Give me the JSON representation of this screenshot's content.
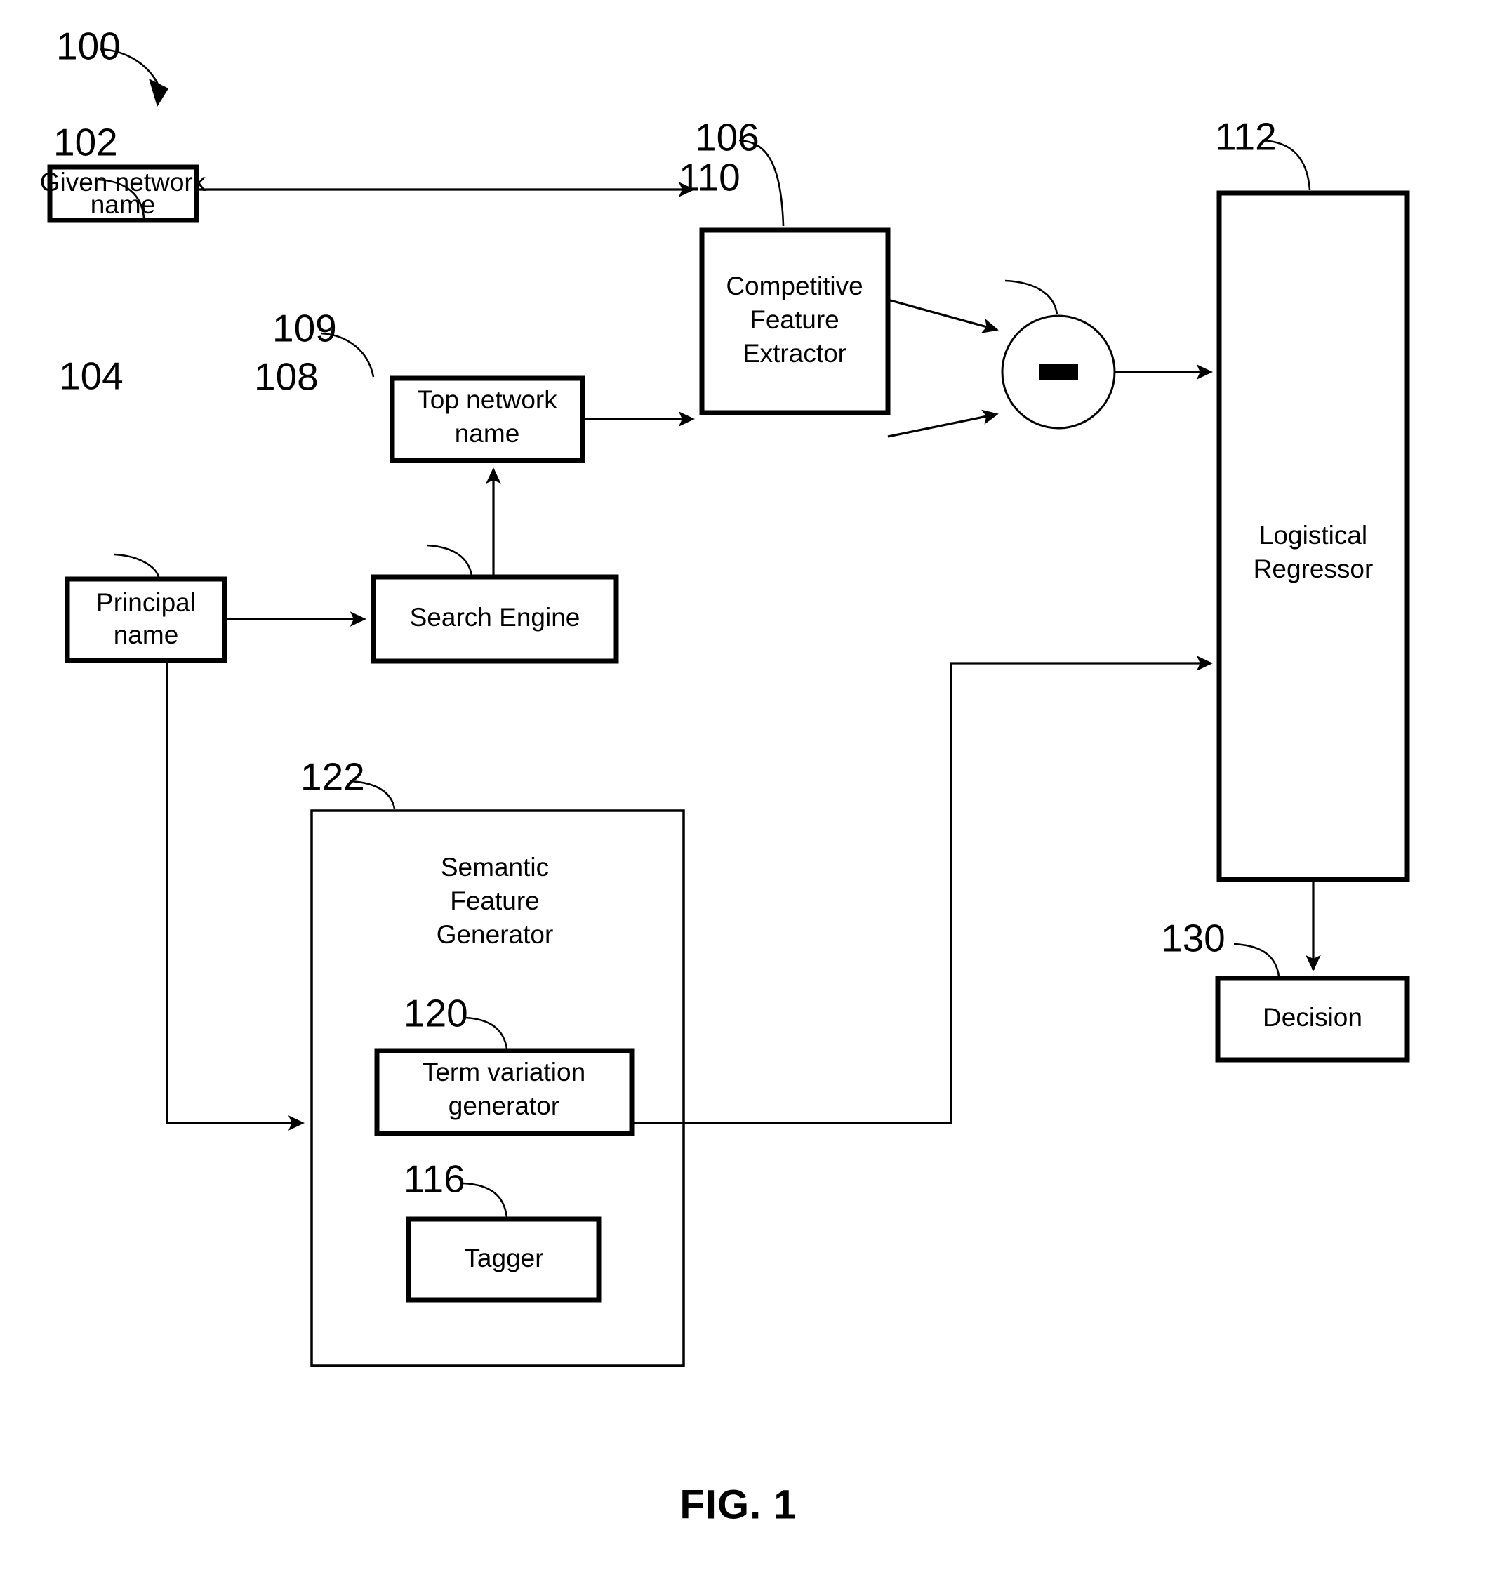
{
  "figure": {
    "caption": "FIG. 1",
    "system_ref": "100"
  },
  "nodes": [
    {
      "id": "given_network_name",
      "ref": "102",
      "label_lines": [
        "Given network",
        "name"
      ],
      "shape": "rect"
    },
    {
      "id": "principal_name",
      "ref": "104",
      "label_lines": [
        "Principal",
        "name"
      ],
      "shape": "rect"
    },
    {
      "id": "competitive_feature_extractor",
      "ref": "106",
      "label_lines": [
        "Competitive",
        "Feature",
        "Extractor"
      ],
      "shape": "rect"
    },
    {
      "id": "search_engine",
      "ref": "108",
      "label_lines": [
        "Search Engine"
      ],
      "shape": "rect"
    },
    {
      "id": "top_network_name",
      "ref": "109",
      "label_lines": [
        "Top network",
        "name"
      ],
      "shape": "rect"
    },
    {
      "id": "subtract_node",
      "ref": "110",
      "label_lines": [],
      "shape": "circle",
      "operator": "minus"
    },
    {
      "id": "logistical_regressor",
      "ref": "112",
      "label_lines": [
        "Logistical",
        "Regressor"
      ],
      "shape": "rect"
    },
    {
      "id": "tagger",
      "ref": "116",
      "label_lines": [
        "Tagger"
      ],
      "shape": "rect"
    },
    {
      "id": "term_variation_generator",
      "ref": "120",
      "label_lines": [
        "Term variation",
        "generator"
      ],
      "shape": "rect"
    },
    {
      "id": "semantic_feature_generator",
      "ref": "122",
      "label_lines": [
        "Semantic",
        "Feature",
        "Generator"
      ],
      "shape": "rect"
    },
    {
      "id": "decision",
      "ref": "130",
      "label_lines": [
        "Decision"
      ],
      "shape": "rect"
    }
  ],
  "edges": [
    {
      "from": "given_network_name",
      "to": "competitive_feature_extractor"
    },
    {
      "from": "top_network_name",
      "to": "competitive_feature_extractor"
    },
    {
      "from": "principal_name",
      "to": "search_engine"
    },
    {
      "from": "search_engine",
      "to": "top_network_name"
    },
    {
      "from": "competitive_feature_extractor",
      "to": "subtract_node"
    },
    {
      "from": "competitive_feature_extractor",
      "to": "subtract_node"
    },
    {
      "from": "subtract_node",
      "to": "logistical_regressor"
    },
    {
      "from": "principal_name",
      "to": "semantic_feature_generator"
    },
    {
      "from": "term_variation_generator",
      "to": "logistical_regressor"
    },
    {
      "from": "logistical_regressor",
      "to": "decision"
    }
  ]
}
